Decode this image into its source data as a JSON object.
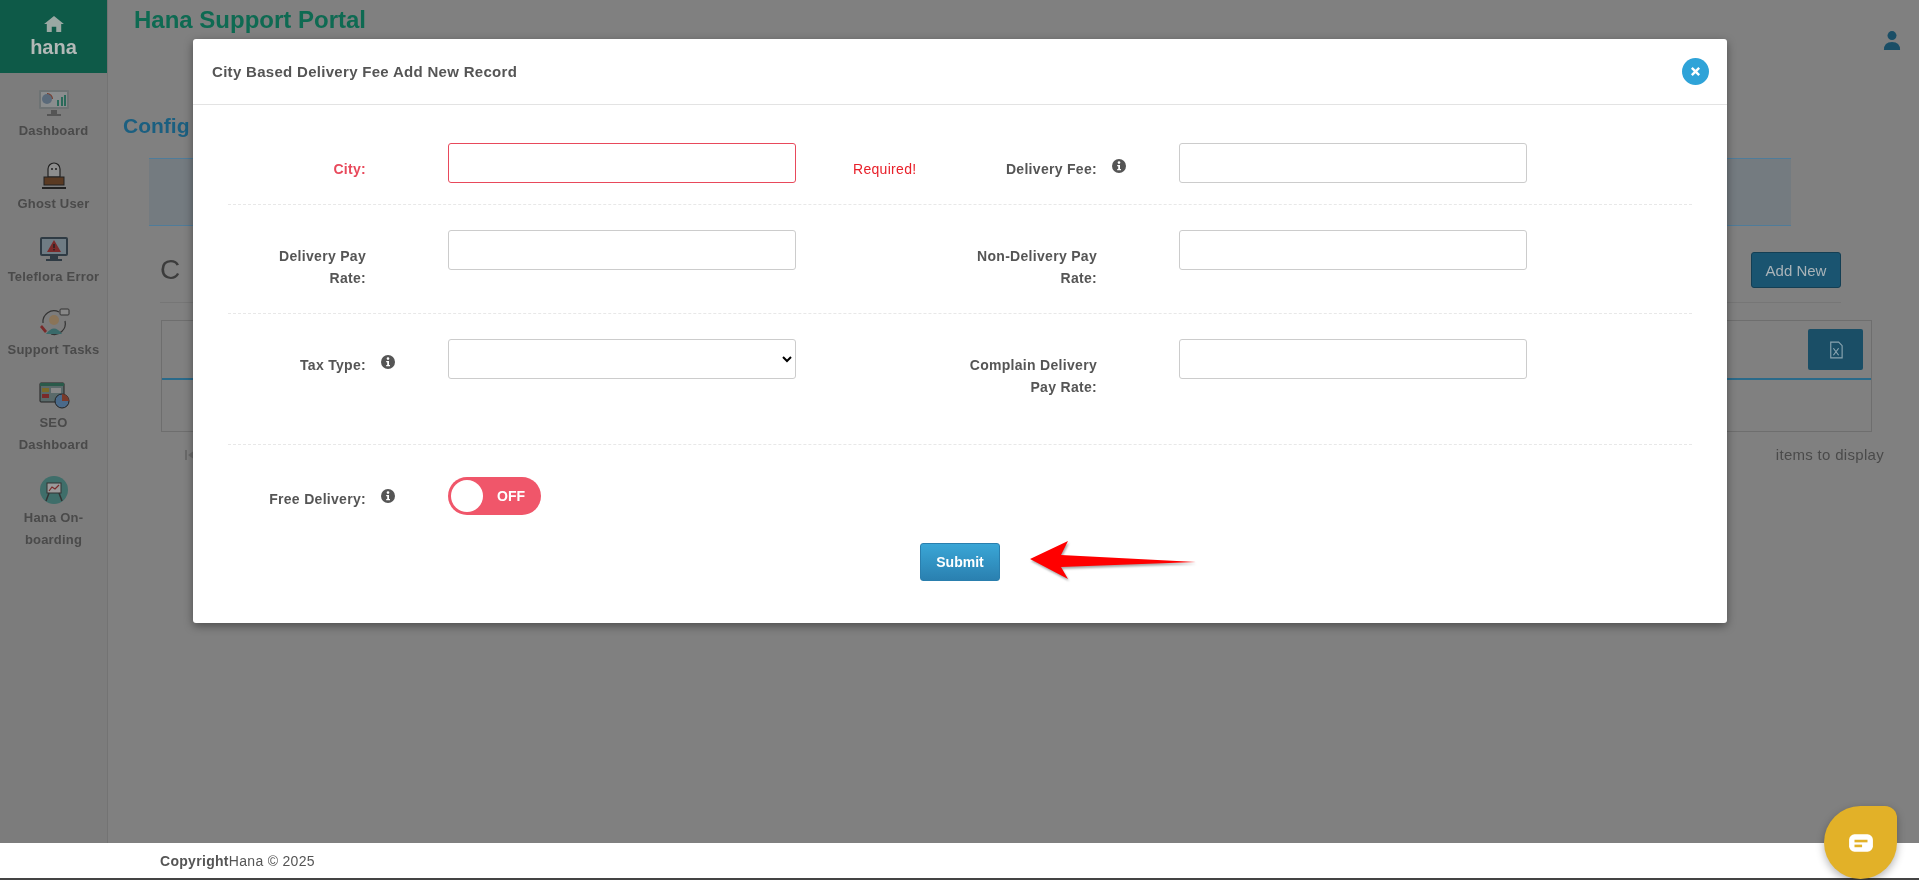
{
  "sidebar": {
    "logo": "hana",
    "items": [
      {
        "label": "Dashboard"
      },
      {
        "label": "Ghost User"
      },
      {
        "label": "Teleflora Error"
      },
      {
        "label": "Support Tasks"
      },
      {
        "label": "SEO Dashboard"
      },
      {
        "label": "Hana On-boarding"
      }
    ]
  },
  "header": {
    "title": "Hana Support Portal"
  },
  "page": {
    "title": "Config",
    "section_title": "C",
    "add_button": "Add New",
    "pager_text": "items to display"
  },
  "modal": {
    "title": "City Based Delivery Fee Add New Record",
    "rows": [
      {
        "fields": [
          {
            "kind": "text",
            "label": "City:",
            "info": false,
            "invalid": true,
            "message": "Required!"
          },
          {
            "kind": "text",
            "label": "Delivery Fee:",
            "info": true,
            "invalid": false
          }
        ]
      },
      {
        "fields": [
          {
            "kind": "text",
            "label": "Delivery Pay Rate:",
            "info": false,
            "invalid": false
          },
          {
            "kind": "text",
            "label": "Non-Delivery Pay Rate:",
            "info": false,
            "invalid": false
          }
        ]
      },
      {
        "fields": [
          {
            "kind": "select",
            "label": "Tax Type:",
            "info": true,
            "invalid": false
          },
          {
            "kind": "text",
            "label": "Complain Delivery Pay Rate:",
            "info": false,
            "invalid": false
          }
        ]
      },
      {
        "fields": [
          {
            "kind": "toggle",
            "label": "Free Delivery:",
            "info": true,
            "on": false,
            "state_text": "OFF"
          }
        ]
      }
    ],
    "submit": "Submit"
  },
  "footer": {
    "text": "**Copyright**Hana © 2025"
  }
}
